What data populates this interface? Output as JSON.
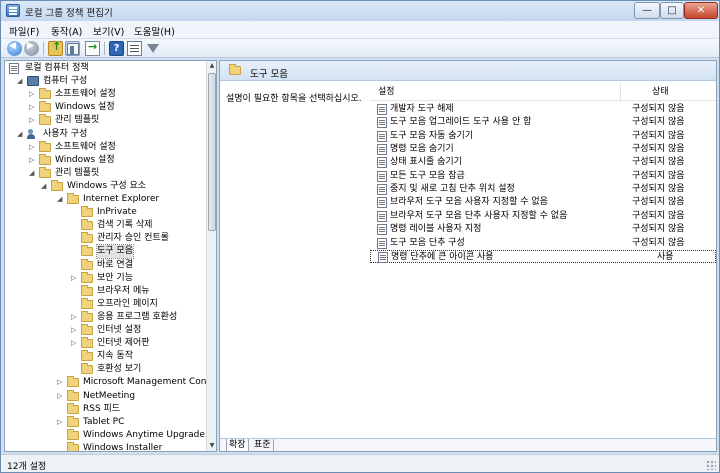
{
  "window": {
    "title": "로컬 그룹 정책 편집기"
  },
  "menu": [
    "파일(F)",
    "동작(A)",
    "보기(V)",
    "도움말(H)"
  ],
  "tree": [
    {
      "label": "로컬 컴퓨터 정책",
      "level": 0,
      "icon": "policy",
      "expander": ""
    },
    {
      "label": "컴퓨터 구성",
      "level": 1,
      "icon": "computer",
      "expander": "◢"
    },
    {
      "label": "소프트웨어 설정",
      "level": 2,
      "icon": "folder",
      "expander": "▷"
    },
    {
      "label": "Windows 설정",
      "level": 2,
      "icon": "folder",
      "expander": "▷"
    },
    {
      "label": "관리 템플릿",
      "level": 2,
      "icon": "folder",
      "expander": "▷"
    },
    {
      "label": "사용자 구성",
      "level": 1,
      "icon": "users",
      "expander": "◢"
    },
    {
      "label": "소프트웨어 설정",
      "level": 2,
      "icon": "folder",
      "expander": "▷"
    },
    {
      "label": "Windows 설정",
      "level": 2,
      "icon": "folder",
      "expander": "▷"
    },
    {
      "label": "관리 템플릿",
      "level": 2,
      "icon": "folder",
      "expander": "◢"
    },
    {
      "label": "Windows 구성 요소",
      "level": 3,
      "icon": "folder",
      "expander": "◢"
    },
    {
      "label": "Internet Explorer",
      "level": 4,
      "icon": "folder",
      "expander": "◢"
    },
    {
      "label": "InPrivate",
      "level": 5,
      "icon": "folder",
      "expander": ""
    },
    {
      "label": "검색 기록 삭제",
      "level": 5,
      "icon": "folder",
      "expander": ""
    },
    {
      "label": "관리자 승인 컨트롤",
      "level": 5,
      "icon": "folder",
      "expander": ""
    },
    {
      "label": "도구 모음",
      "level": 5,
      "icon": "folder",
      "expander": "",
      "selected": true
    },
    {
      "label": "바로 연결",
      "level": 5,
      "icon": "folder",
      "expander": ""
    },
    {
      "label": "보안 기능",
      "level": 5,
      "icon": "folder",
      "expander": "▷"
    },
    {
      "label": "브라우저 메뉴",
      "level": 5,
      "icon": "folder",
      "expander": ""
    },
    {
      "label": "오프라인 페이지",
      "level": 5,
      "icon": "folder",
      "expander": ""
    },
    {
      "label": "응용 프로그램 호환성",
      "level": 5,
      "icon": "folder",
      "expander": "▷"
    },
    {
      "label": "인터넷 설정",
      "level": 5,
      "icon": "folder",
      "expander": "▷"
    },
    {
      "label": "인터넷 제어판",
      "level": 5,
      "icon": "folder",
      "expander": "▷"
    },
    {
      "label": "지속 동작",
      "level": 5,
      "icon": "folder",
      "expander": ""
    },
    {
      "label": "호환성 보기",
      "level": 5,
      "icon": "folder",
      "expander": ""
    },
    {
      "label": "Microsoft Management Console",
      "level": 4,
      "icon": "folder",
      "expander": "▷"
    },
    {
      "label": "NetMeeting",
      "level": 4,
      "icon": "folder",
      "expander": "▷"
    },
    {
      "label": "RSS 피드",
      "level": 4,
      "icon": "folder",
      "expander": ""
    },
    {
      "label": "Tablet PC",
      "level": 4,
      "icon": "folder",
      "expander": "▷"
    },
    {
      "label": "Windows Anytime Upgrade",
      "level": 4,
      "icon": "folder",
      "expander": ""
    },
    {
      "label": "Windows Installer",
      "level": 4,
      "icon": "folder",
      "expander": ""
    }
  ],
  "content": {
    "header_title": "도구 모음",
    "description": "설명이 필요한 항목을 선택하십시오.",
    "columns": {
      "setting": "설정",
      "state": "상태"
    },
    "rows": [
      {
        "name": "개발자 도구 해제",
        "state": "구성되지 않음"
      },
      {
        "name": "도구 모음 업그레이드 도구 사용 안 함",
        "state": "구성되지 않음"
      },
      {
        "name": "도구 모음 자동 숨기기",
        "state": "구성되지 않음"
      },
      {
        "name": "명령 모음 숨기기",
        "state": "구성되지 않음"
      },
      {
        "name": "상태 표시줄 숨기기",
        "state": "구성되지 않음"
      },
      {
        "name": "모든 도구 모음 잠금",
        "state": "구성되지 않음"
      },
      {
        "name": "중지 및 새로 고침 단추 위치 설정",
        "state": "구성되지 않음"
      },
      {
        "name": "브라우저 도구 모음 사용자 지정할 수 없음",
        "state": "구성되지 않음"
      },
      {
        "name": "브라우저 도구 모음 단추 사용자 지정할 수 없음",
        "state": "구성되지 않음"
      },
      {
        "name": "명령 레이블 사용자 지정",
        "state": "구성되지 않음"
      },
      {
        "name": "도구 모음 단추 구성",
        "state": "구성되지 않음"
      },
      {
        "name": "명령 단추에 큰 아이콘 사용",
        "state": "사용",
        "selected": true
      }
    ],
    "tabs": [
      "확장",
      "표준"
    ]
  },
  "status": {
    "text": "12개 설정"
  }
}
